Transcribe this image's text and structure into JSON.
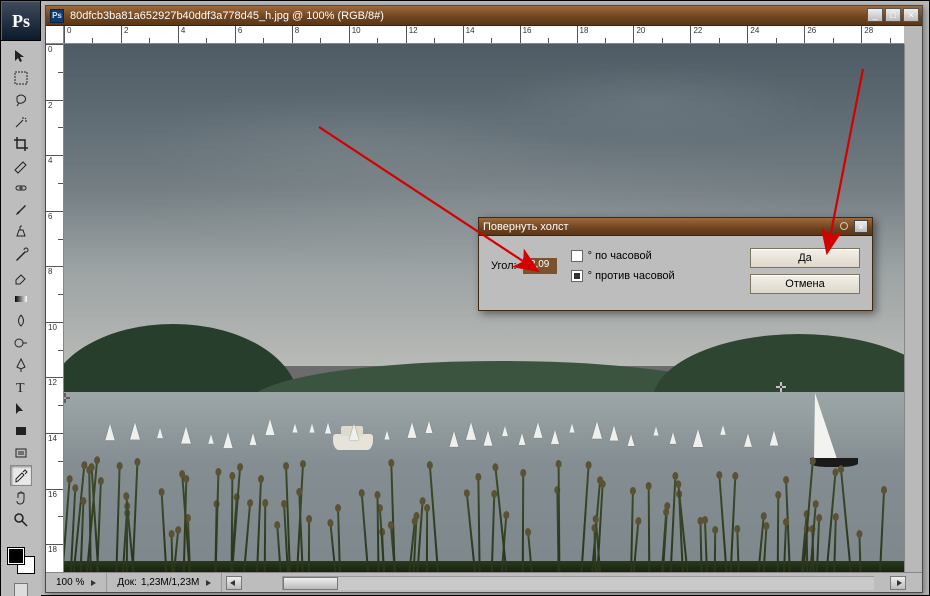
{
  "app": {
    "logo": "Ps"
  },
  "document": {
    "title": "80dfcb3ba81a652927b40ddf3a778d45_h.jpg @ 100% (RGB/8#)",
    "zoom": "100 %",
    "doc_size_label": "Док:",
    "doc_size": "1,23M/1,23M"
  },
  "ruler": {
    "h_labels": [
      "0",
      "2",
      "4",
      "6",
      "8",
      "10",
      "12",
      "14",
      "16",
      "18",
      "20",
      "22",
      "24",
      "26",
      "28"
    ],
    "v_labels": [
      "0",
      "2",
      "4",
      "6",
      "8",
      "10",
      "12",
      "14",
      "16",
      "18"
    ]
  },
  "toolbox": {
    "tools": [
      "move-tool",
      "marquee-tool",
      "lasso-tool",
      "magic-wand-tool",
      "crop-tool",
      "slice-tool",
      "healing-brush-tool",
      "brush-tool",
      "clone-stamp-tool",
      "history-brush-tool",
      "eraser-tool",
      "gradient-tool",
      "blur-tool",
      "dodge-tool",
      "pen-tool",
      "type-tool",
      "path-selection-tool",
      "rectangle-tool",
      "notes-tool",
      "eyedropper-tool",
      "hand-tool",
      "zoom-tool"
    ],
    "active_tool_index": 19
  },
  "dialog": {
    "title": "Повернуть холст",
    "angle_label": "Угол:",
    "angle_value": "2,09",
    "radio_cw": "° по часовой",
    "radio_ccw": "° против часовой",
    "selected_radio": "ccw",
    "ok": "Да",
    "cancel": "Отмена"
  },
  "window_controls": {
    "minimize": "_",
    "maximize": "□",
    "close": "×"
  }
}
